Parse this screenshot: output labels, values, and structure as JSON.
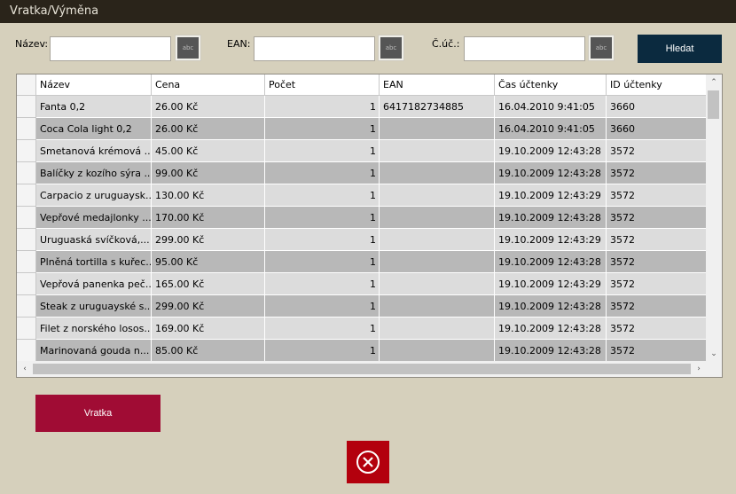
{
  "window": {
    "title": "Vratka/Výměna"
  },
  "search": {
    "name_label": "Název:",
    "ean_label": "EAN:",
    "receipt_label": "Č.úč.:",
    "name_value": "",
    "ean_value": "",
    "receipt_value": "",
    "keyboard_label": "abc",
    "search_button": "Hledat"
  },
  "table": {
    "columns": [
      "Název",
      "Cena",
      "Počet",
      "EAN",
      "Čas účtenky",
      "ID účtenky"
    ],
    "rows": [
      [
        "Fanta 0,2",
        "26.00 Kč",
        "1",
        "6417182734885",
        "16.04.2010 9:41:05",
        "3660"
      ],
      [
        "Coca Cola light 0,2",
        "26.00 Kč",
        "1",
        "",
        "16.04.2010 9:41:05",
        "3660"
      ],
      [
        "Smetanová krémová ...",
        "45.00 Kč",
        "1",
        "",
        "19.10.2009 12:43:28",
        "3572"
      ],
      [
        "Balíčky z kozího sýra ...",
        "99.00 Kč",
        "1",
        "",
        "19.10.2009 12:43:28",
        "3572"
      ],
      [
        "Carpacio z uruguaysk...",
        "130.00 Kč",
        "1",
        "",
        "19.10.2009 12:43:29",
        "3572"
      ],
      [
        "Vepřové medajlonky ...",
        "170.00 Kč",
        "1",
        "",
        "19.10.2009 12:43:28",
        "3572"
      ],
      [
        "Uruguaská svíčková,...",
        "299.00 Kč",
        "1",
        "",
        "19.10.2009 12:43:29",
        "3572"
      ],
      [
        "Plněná tortilla s kuřec...",
        "95.00 Kč",
        "1",
        "",
        "19.10.2009 12:43:28",
        "3572"
      ],
      [
        "Vepřová panenka peč...",
        "165.00 Kč",
        "1",
        "",
        "19.10.2009 12:43:29",
        "3572"
      ],
      [
        "Steak z uruguayské s...",
        "299.00 Kč",
        "1",
        "",
        "19.10.2009 12:43:28",
        "3572"
      ],
      [
        "Filet z norského losos...",
        "169.00 Kč",
        "1",
        "",
        "19.10.2009 12:43:28",
        "3572"
      ],
      [
        "Marinovaná gouda n...",
        "85.00 Kč",
        "1",
        "",
        "19.10.2009 12:43:28",
        "3572"
      ]
    ]
  },
  "actions": {
    "return_button": "Vratka"
  },
  "colors": {
    "title_bar": "#2a241a",
    "search_button": "#0b2a3f",
    "return_button": "#a00c34",
    "close_button": "#b3000d"
  },
  "icons": {
    "close": "close-circle-icon"
  }
}
